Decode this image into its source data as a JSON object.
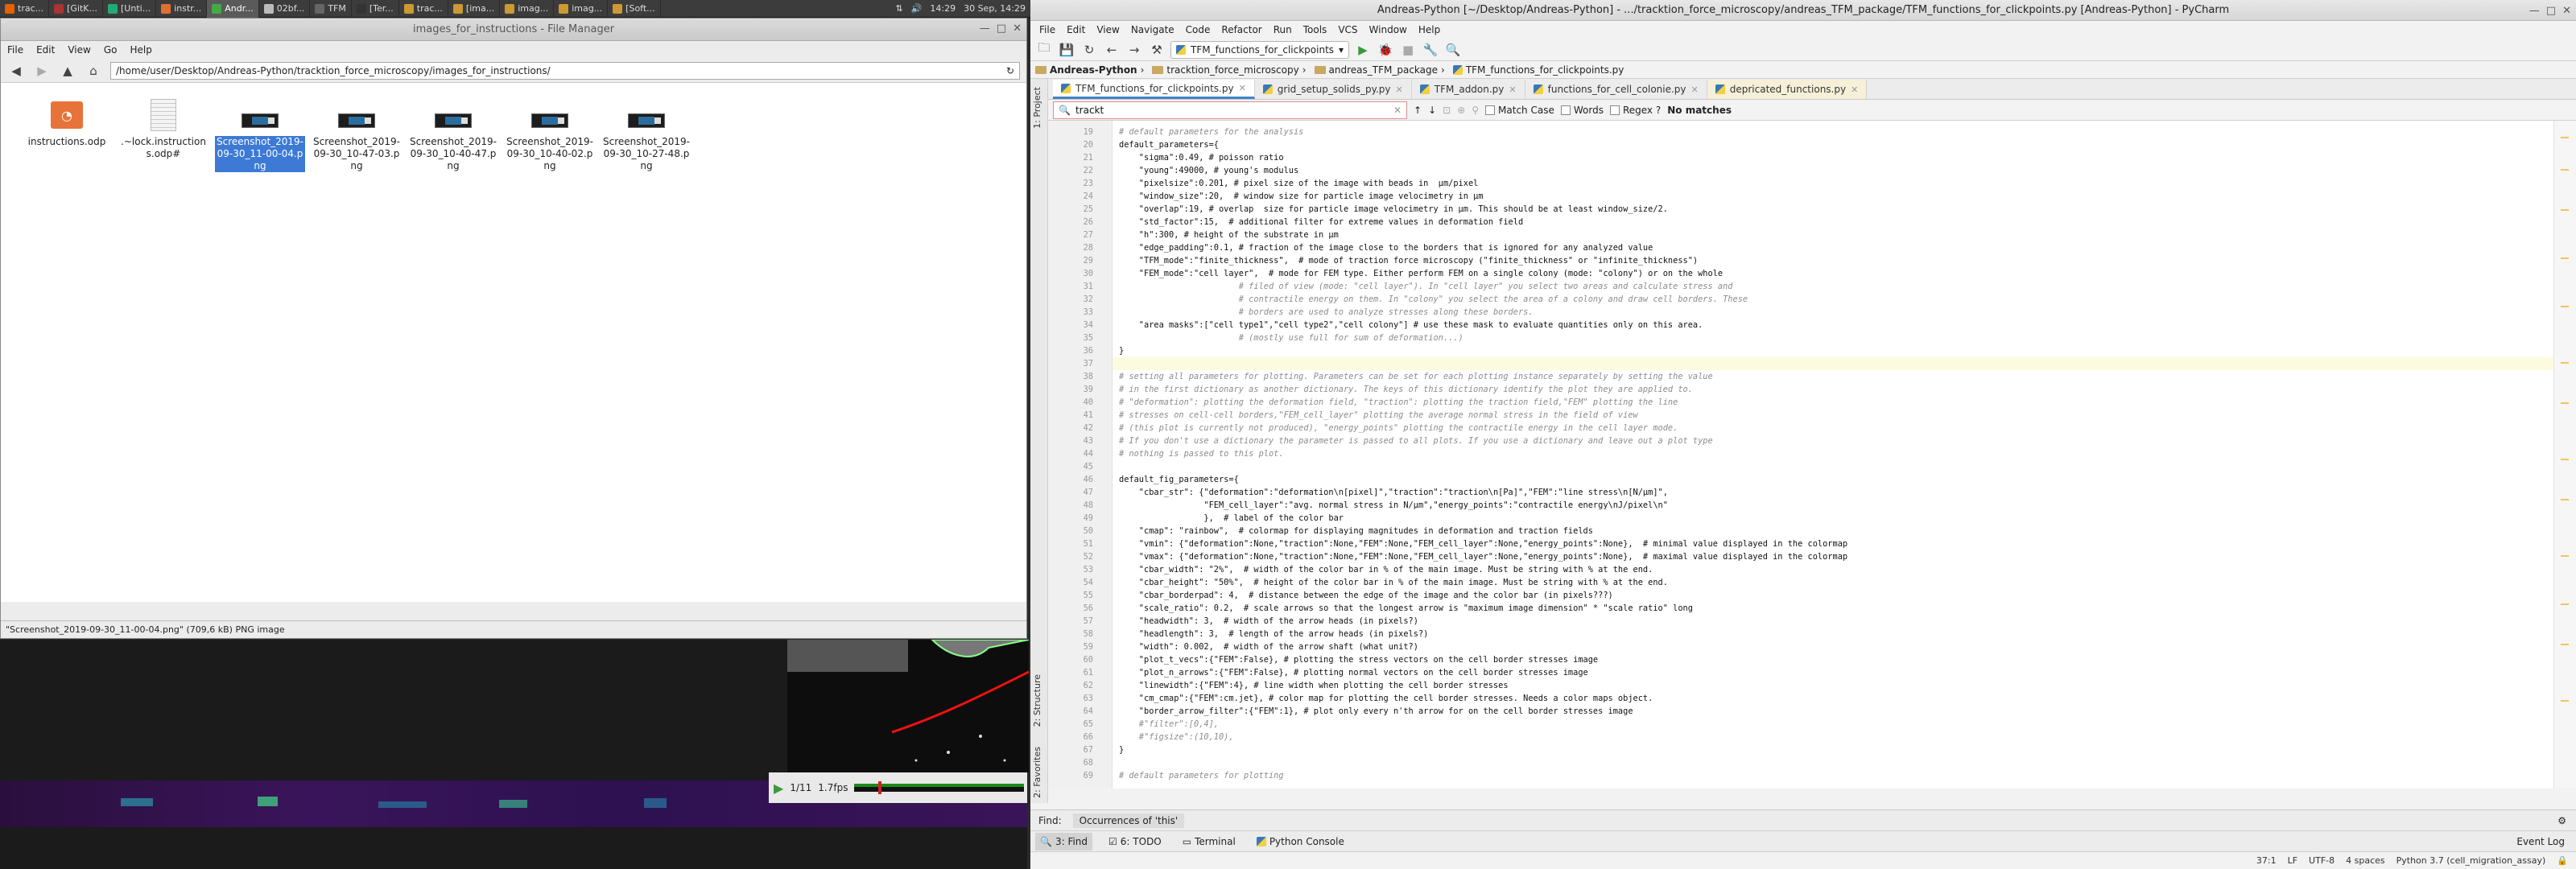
{
  "left_panel": {
    "tasks": [
      {
        "label": "trac...",
        "color": "#e66000"
      },
      {
        "label": "[GitK...",
        "color": "#a33"
      },
      {
        "label": "[Unti...",
        "color": "#2a7"
      },
      {
        "label": "instr...",
        "color": "#e07030"
      },
      {
        "label": "Andr...",
        "color": "#4a4",
        "active": true
      },
      {
        "label": "02bf...",
        "color": "#bbb"
      },
      {
        "label": "TFM",
        "color": "#666"
      },
      {
        "label": "[Ter...",
        "color": "#333"
      },
      {
        "label": "trac...",
        "color": "#c93"
      },
      {
        "label": "[ima...",
        "color": "#c93"
      },
      {
        "label": "imag...",
        "color": "#c93"
      },
      {
        "label": "imag...",
        "color": "#c93"
      },
      {
        "label": "[Soft...",
        "color": "#c93"
      }
    ],
    "clock": "14:29",
    "date": "30 Sep, 14:29"
  },
  "file_manager": {
    "title": "images_for_instructions - File Manager",
    "menu": [
      "File",
      "Edit",
      "View",
      "Go",
      "Help"
    ],
    "path": "/home/user/Desktop/Andreas-Python/tracktion_force_microscopy/images_for_instructions/",
    "files": [
      {
        "name": "instructions.odp",
        "kind": "odp"
      },
      {
        "name": ".~lock.instructions.odp#",
        "kind": "txt"
      },
      {
        "name": "Screenshot_2019-09-30_11-00-04.png",
        "kind": "png",
        "selected": true
      },
      {
        "name": "Screenshot_2019-09-30_10-47-03.png",
        "kind": "png"
      },
      {
        "name": "Screenshot_2019-09-30_10-40-47.png",
        "kind": "png"
      },
      {
        "name": "Screenshot_2019-09-30_10-40-02.png",
        "kind": "png"
      },
      {
        "name": "Screenshot_2019-09-30_10-27-48.png",
        "kind": "png"
      }
    ],
    "status": "\"Screenshot_2019-09-30_11-00-04.png\" (709,6 kB) PNG image"
  },
  "video": {
    "frame_info": "1/11",
    "fps": "1.7fps"
  },
  "pycharm": {
    "title": "Andreas-Python [~/Desktop/Andreas-Python] - .../tracktion_force_microscopy/andreas_TFM_package/TFM_functions_for_clickpoints.py [Andreas-Python] - PyCharm",
    "menu": [
      "File",
      "Edit",
      "View",
      "Navigate",
      "Code",
      "Refactor",
      "Run",
      "Tools",
      "VCS",
      "Window",
      "Help"
    ],
    "run_config": "TFM_functions_for_clickpoints",
    "breadcrumbs": [
      "Andreas-Python",
      "tracktion_force_microscopy",
      "andreas_TFM_package",
      "TFM_functions_for_clickpoints.py"
    ],
    "tabs": [
      {
        "label": "TFM_functions_for_clickpoints.py",
        "active": true
      },
      {
        "label": "grid_setup_solids_py.py"
      },
      {
        "label": "TFM_addon.py"
      },
      {
        "label": "functions_for_cell_colonie.py"
      },
      {
        "label": "depricated_functions.py"
      }
    ],
    "find": {
      "query": "trackt",
      "match_case": "Match Case",
      "words": "Words",
      "regex": "Regex",
      "regex_help": "?",
      "result": "No matches"
    },
    "left_tool_tabs": [
      "1: Project",
      "2: Structure",
      "2: Favorites"
    ],
    "code_lines": [
      {
        "n": "19",
        "t": "# default parameters for the analysis",
        "c": "cm"
      },
      {
        "n": "20",
        "t": "default_parameters={",
        "c": ""
      },
      {
        "n": "21",
        "t": "    \"sigma\":0.49, # poisson ratio",
        "c": ""
      },
      {
        "n": "22",
        "t": "    \"young\":49000, # young's modulus",
        "c": ""
      },
      {
        "n": "23",
        "t": "    \"pixelsize\":0.201, # pixel size of the image with beads in  µm/pixel",
        "c": ""
      },
      {
        "n": "24",
        "t": "    \"window_size\":20,  # window size for particle image velocimetry in µm",
        "c": ""
      },
      {
        "n": "25",
        "t": "    \"overlap\":19, # overlap  size for particle image velocimetry in µm. This should be at least window_size/2.",
        "c": ""
      },
      {
        "n": "26",
        "t": "    \"std_factor\":15,  # additional filter for extreme values in deformation field",
        "c": ""
      },
      {
        "n": "27",
        "t": "    \"h\":300, # height of the substrate in µm",
        "c": ""
      },
      {
        "n": "28",
        "t": "    \"edge_padding\":0.1, # fraction of the image close to the borders that is ignored for any analyzed value",
        "c": ""
      },
      {
        "n": "29",
        "t": "    \"TFM_mode\":\"finite_thickness\",  # mode of traction force microscopy (\"finite_thickness\" or \"infinite_thickness\")",
        "c": ""
      },
      {
        "n": "30",
        "t": "    \"FEM_mode\":\"cell layer\",  # mode for FEM type. Either perform FEM on a single colony (mode: \"colony\") or on the whole",
        "c": ""
      },
      {
        "n": "31",
        "t": "                        # filed of view (mode: \"cell layer\"). In \"cell layer\" you select two areas and calculate stress and",
        "c": "cm"
      },
      {
        "n": "32",
        "t": "                        # contractile energy on them. In \"colony\" you select the area of a colony and draw cell borders. These",
        "c": "cm"
      },
      {
        "n": "33",
        "t": "                        # borders are used to analyze stresses along these borders.",
        "c": "cm"
      },
      {
        "n": "34",
        "t": "    \"area masks\":[\"cell type1\",\"cell type2\",\"cell colony\"] # use these mask to evaluate quantities only on this area.",
        "c": ""
      },
      {
        "n": "35",
        "t": "                        # (mostly use full for sum of deformation...)",
        "c": "cm"
      },
      {
        "n": "36",
        "t": "}",
        "c": ""
      },
      {
        "n": "37",
        "t": "",
        "c": ""
      },
      {
        "n": "38",
        "t": "# setting all parameters for plotting. Parameters can be set for each plotting instance separately by setting the value",
        "c": "cm"
      },
      {
        "n": "39",
        "t": "# in the first dictionary as another dictionary. The keys of this dictionary identify the plot they are applied to.",
        "c": "cm"
      },
      {
        "n": "40",
        "t": "# \"deformation\": plotting the deformation field, \"traction\": plotting the traction field,\"FEM\" plotting the line",
        "c": "cm"
      },
      {
        "n": "41",
        "t": "# stresses on cell-cell borders,\"FEM_cell_layer\" plotting the average normal stress in the field of view",
        "c": "cm"
      },
      {
        "n": "42",
        "t": "# (this plot is currently not produced), \"energy_points\" plotting the contractile energy in the cell layer mode.",
        "c": "cm"
      },
      {
        "n": "43",
        "t": "# If you don't use a dictionary the parameter is passed to all plots. If you use a dictionary and leave out a plot type",
        "c": "cm"
      },
      {
        "n": "44",
        "t": "# nothing is passed to this plot.",
        "c": "cm"
      },
      {
        "n": "45",
        "t": "",
        "c": ""
      },
      {
        "n": "46",
        "t": "default_fig_parameters={",
        "c": ""
      },
      {
        "n": "47",
        "t": "    \"cbar_str\": {\"deformation\":\"deformation\\n[pixel]\",\"traction\":\"traction\\n[Pa]\",\"FEM\":\"line stress\\n[N/µm]\",",
        "c": ""
      },
      {
        "n": "48",
        "t": "                 \"FEM_cell_layer\":\"avg. normal stress in N/µm\",\"energy_points\":\"contractile energy\\nJ/pixel\\n\"",
        "c": ""
      },
      {
        "n": "49",
        "t": "                 },  # label of the color bar",
        "c": ""
      },
      {
        "n": "50",
        "t": "    \"cmap\": \"rainbow\",  # colormap for displaying magnitudes in deformation and traction fields",
        "c": ""
      },
      {
        "n": "51",
        "t": "    \"vmin\": {\"deformation\":None,\"traction\":None,\"FEM\":None,\"FEM_cell_layer\":None,\"energy_points\":None},  # minimal value displayed in the colormap",
        "c": ""
      },
      {
        "n": "52",
        "t": "    \"vmax\": {\"deformation\":None,\"traction\":None,\"FEM\":None,\"FEM_cell_layer\":None,\"energy_points\":None},  # maximal value displayed in the colormap",
        "c": ""
      },
      {
        "n": "53",
        "t": "    \"cbar_width\": \"2%\",  # width of the color bar in % of the main image. Must be string with % at the end.",
        "c": ""
      },
      {
        "n": "54",
        "t": "    \"cbar_height\": \"50%\",  # height of the color bar in % of the main image. Must be string with % at the end.",
        "c": ""
      },
      {
        "n": "55",
        "t": "    \"cbar_borderpad\": 4,  # distance between the edge of the image and the color bar (in pixels???)",
        "c": ""
      },
      {
        "n": "56",
        "t": "    \"scale_ratio\": 0.2,  # scale arrows so that the longest arrow is \"maximum image dimension\" * \"scale ratio\" long",
        "c": ""
      },
      {
        "n": "57",
        "t": "    \"headwidth\": 3,  # width of the arrow heads (in pixels?)",
        "c": ""
      },
      {
        "n": "58",
        "t": "    \"headlength\": 3,  # length of the arrow heads (in pixels?)",
        "c": ""
      },
      {
        "n": "59",
        "t": "    \"width\": 0.002,  # width of the arrow shaft (what unit?)",
        "c": ""
      },
      {
        "n": "60",
        "t": "    \"plot_t_vecs\":{\"FEM\":False}, # plotting the stress vectors on the cell border stresses image",
        "c": ""
      },
      {
        "n": "61",
        "t": "    \"plot_n_arrows\":{\"FEM\":False}, # plotting normal vectors on the cell border stresses image",
        "c": ""
      },
      {
        "n": "62",
        "t": "    \"linewidth\":{\"FEM\":4}, # line width when plotting the cell border stresses",
        "c": ""
      },
      {
        "n": "63",
        "t": "    \"cm_cmap\":{\"FEM\":cm.jet}, # color map for plotting the cell border stresses. Needs a color maps object.",
        "c": ""
      },
      {
        "n": "64",
        "t": "    \"border_arrow_filter\":{\"FEM\":1}, # plot only every n'th arrow for on the cell border stresses image",
        "c": ""
      },
      {
        "n": "65",
        "t": "    #\"filter\":[0,4],",
        "c": "cm"
      },
      {
        "n": "66",
        "t": "    #\"figsize\":(10,10),",
        "c": "cm"
      },
      {
        "n": "67",
        "t": "}",
        "c": ""
      },
      {
        "n": "68",
        "t": "",
        "c": ""
      },
      {
        "n": "69",
        "t": "# default parameters for plotting",
        "c": "cm"
      }
    ],
    "find_bar": {
      "label": "Find:",
      "tab": "Occurrences of 'this'"
    },
    "tool_windows": [
      {
        "label": "3: Find",
        "active": true
      },
      {
        "label": "6: TODO"
      },
      {
        "label": "Terminal"
      },
      {
        "label": "Python Console"
      }
    ],
    "event_log": "Event Log",
    "status": {
      "position": "37:1",
      "line_sep": "LF",
      "encoding": "UTF-8",
      "indent": "4 spaces",
      "interpreter": "Python 3.7 (cell_migration_assay)"
    }
  },
  "colors": {
    "selection": "#3d7ad6",
    "string": "#067d17",
    "comment": "#8c8c8c",
    "tab_accent": "#4083c9"
  }
}
